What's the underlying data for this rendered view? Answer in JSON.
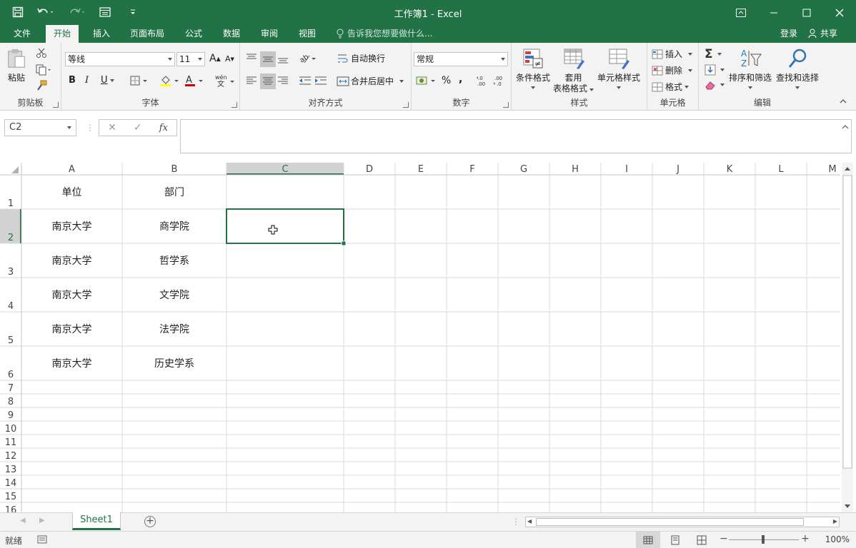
{
  "window": {
    "title": "工作簿1 - Excel"
  },
  "tabs": [
    "文件",
    "开始",
    "插入",
    "页面布局",
    "公式",
    "数据",
    "审阅",
    "视图"
  ],
  "active_tab": "开始",
  "tell_me": "告诉我您想要做什么...",
  "login": "登录",
  "share": "共享",
  "ribbon": {
    "clipboard": {
      "label": "剪贴板",
      "paste": "粘贴"
    },
    "font": {
      "label": "字体",
      "font_name": "等线",
      "font_size": "11",
      "bold": "B",
      "italic": "I",
      "underline": "U",
      "grow": "A",
      "shrink": "A"
    },
    "alignment": {
      "label": "对齐方式",
      "wrap": "自动换行",
      "merge": "合并后居中"
    },
    "number": {
      "label": "数字",
      "format": "常规",
      "percent": "%",
      "comma": ","
    },
    "styles": {
      "label": "样式",
      "conditional": "条件格式",
      "table_line1": "套用",
      "table_line2": "表格格式",
      "cell_styles": "单元格样式"
    },
    "cells": {
      "label": "单元格",
      "insert": "插入",
      "delete": "删除",
      "format": "格式"
    },
    "editing": {
      "label": "编辑",
      "sort": "排序和筛选",
      "find": "查找和选择"
    }
  },
  "formula_bar": {
    "name_box": "C2",
    "fx": "fx",
    "value": ""
  },
  "sheet": {
    "columns": [
      "A",
      "B",
      "C",
      "D",
      "E",
      "F",
      "G",
      "H",
      "I",
      "J",
      "K",
      "L",
      "M"
    ],
    "rows": [
      "1",
      "2",
      "3",
      "4",
      "5",
      "6",
      "7",
      "8",
      "9",
      "10",
      "11",
      "12",
      "13",
      "14",
      "15",
      "16"
    ],
    "cells": [
      [
        "单位",
        "部门"
      ],
      [
        "南京大学",
        "商学院"
      ],
      [
        "南京大学",
        "哲学系"
      ],
      [
        "南京大学",
        "文学院"
      ],
      [
        "南京大学",
        "法学院"
      ],
      [
        "南京大学",
        "历史学系"
      ]
    ],
    "selected_cell": "C2"
  },
  "sheet_tabs": [
    "Sheet1"
  ],
  "status": {
    "ready": "就绪",
    "zoom": "100%"
  },
  "colors": {
    "accent": "#217346",
    "ribbon_bg": "#f3f3f3",
    "grid_line": "#d4d4d4"
  }
}
